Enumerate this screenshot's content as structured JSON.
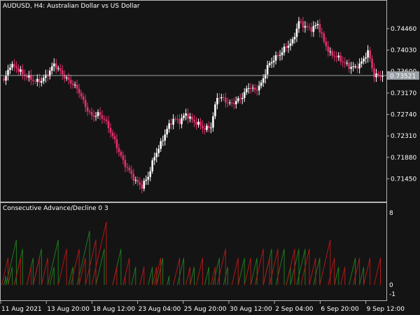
{
  "main_chart": {
    "title": "AUDUSD, H4:  Australian Dollar vs US Dollar",
    "current_price_label": "0.73521",
    "current_price": 0.73521,
    "price_label_overlap": "0.73600"
  },
  "indicator": {
    "title": "Consecutive Advance/Decline 0 3"
  },
  "colors": {
    "background": "#141414",
    "frame": "#b4b4b4",
    "bull_candle": "#ffffff",
    "bear_candle": "#e0306a",
    "price_line": "#9aa0a6",
    "price_label_bg": "#9aa0a6",
    "advance_line": "#1f7a1f",
    "decline_line": "#b01818"
  },
  "chart_data": [
    {
      "type": "candlestick",
      "title": "AUDUSD, H4:  Australian Dollar vs US Dollar",
      "price_axis_ticks": [
        "0.74460",
        "0.74030",
        "0.73600",
        "0.73170",
        "0.72740",
        "0.72310",
        "0.71880",
        "0.71450"
      ],
      "time_axis_ticks": [
        "11 Aug 2021",
        "13 Aug 20:00",
        "18 Aug 12:00",
        "23 Aug 04:00",
        "25 Aug 20:00",
        "30 Aug 12:00",
        "2 Sep 04:00",
        "6 Sep 20:00",
        "9 Sep 12:00"
      ],
      "ylim": [
        0.7105,
        0.7495
      ],
      "close_path": [
        [
          0,
          0.734
        ],
        [
          3,
          0.7373
        ],
        [
          6,
          0.7368
        ],
        [
          9,
          0.7355
        ],
        [
          12,
          0.7348
        ],
        [
          15,
          0.734
        ],
        [
          18,
          0.7342
        ],
        [
          21,
          0.7355
        ],
        [
          24,
          0.7375
        ],
        [
          27,
          0.736
        ],
        [
          30,
          0.7345
        ],
        [
          33,
          0.7335
        ],
        [
          36,
          0.732
        ],
        [
          39,
          0.729
        ],
        [
          42,
          0.727
        ],
        [
          45,
          0.7275
        ],
        [
          48,
          0.7265
        ],
        [
          51,
          0.724
        ],
        [
          54,
          0.721
        ],
        [
          57,
          0.718
        ],
        [
          60,
          0.716
        ],
        [
          63,
          0.714
        ],
        [
          66,
          0.713
        ],
        [
          69,
          0.715
        ],
        [
          72,
          0.719
        ],
        [
          75,
          0.7215
        ],
        [
          78,
          0.7245
        ],
        [
          81,
          0.7265
        ],
        [
          84,
          0.726
        ],
        [
          87,
          0.7275
        ],
        [
          90,
          0.7262
        ],
        [
          93,
          0.7255
        ],
        [
          96,
          0.7245
        ],
        [
          99,
          0.725
        ],
        [
          102,
          0.731
        ],
        [
          105,
          0.7305
        ],
        [
          108,
          0.7295
        ],
        [
          111,
          0.73
        ],
        [
          114,
          0.731
        ],
        [
          117,
          0.733
        ],
        [
          120,
          0.7322
        ],
        [
          123,
          0.7335
        ],
        [
          126,
          0.737
        ],
        [
          129,
          0.7385
        ],
        [
          132,
          0.7395
        ],
        [
          135,
          0.741
        ],
        [
          138,
          0.742
        ],
        [
          141,
          0.746
        ],
        [
          144,
          0.745
        ],
        [
          147,
          0.7445
        ],
        [
          150,
          0.7455
        ],
        [
          153,
          0.742
        ],
        [
          156,
          0.7395
        ],
        [
          159,
          0.739
        ],
        [
          162,
          0.738
        ],
        [
          165,
          0.737
        ],
        [
          168,
          0.7368
        ],
        [
          171,
          0.7378
        ],
        [
          174,
          0.74
        ],
        [
          177,
          0.7352
        ]
      ],
      "series": [
        {
          "name": "AUDUSD"
        }
      ]
    },
    {
      "type": "line",
      "title": "Consecutive Advance/Decline 0 3",
      "value_axis_ticks": [
        "8",
        "0",
        "-1"
      ],
      "ylim": [
        -1,
        8
      ],
      "series": [
        {
          "color": "green",
          "peaks": [
            [
              1,
              1
            ],
            [
              4,
              2
            ],
            [
              6,
              5
            ],
            [
              9,
              4
            ],
            [
              14,
              3
            ],
            [
              18,
              4
            ],
            [
              24,
              2
            ],
            [
              26,
              5
            ],
            [
              33,
              2
            ],
            [
              41,
              6
            ],
            [
              48,
              4
            ],
            [
              56,
              4
            ],
            [
              63,
              2
            ],
            [
              71,
              2
            ],
            [
              76,
              3
            ],
            [
              79,
              1
            ],
            [
              86,
              3
            ],
            [
              91,
              2
            ],
            [
              98,
              2
            ],
            [
              103,
              3
            ],
            [
              107,
              2
            ],
            [
              115,
              3
            ],
            [
              121,
              3
            ],
            [
              128,
              4
            ],
            [
              134,
              4
            ],
            [
              137,
              2
            ],
            [
              141,
              4
            ],
            [
              144,
              4
            ],
            [
              151,
              3
            ],
            [
              160,
              2
            ],
            [
              168,
              3
            ],
            [
              172,
              2
            ]
          ]
        },
        {
          "color": "red",
          "peaks": [
            [
              2,
              3
            ],
            [
              8,
              3
            ],
            [
              13,
              2
            ],
            [
              17,
              3
            ],
            [
              21,
              3
            ],
            [
              30,
              4
            ],
            [
              36,
              4
            ],
            [
              39,
              3
            ],
            [
              44,
              5
            ],
            [
              49,
              7
            ],
            [
              54,
              2
            ],
            [
              58,
              1
            ],
            [
              60,
              3
            ],
            [
              67,
              2
            ],
            [
              73,
              2
            ],
            [
              75,
              3
            ],
            [
              84,
              3
            ],
            [
              89,
              2
            ],
            [
              95,
              3
            ],
            [
              101,
              2
            ],
            [
              106,
              4
            ],
            [
              112,
              3
            ],
            [
              118,
              3
            ],
            [
              124,
              4
            ],
            [
              127,
              3
            ],
            [
              131,
              4
            ],
            [
              139,
              4
            ],
            [
              146,
              4
            ],
            [
              149,
              3
            ],
            [
              156,
              5
            ],
            [
              158,
              3
            ],
            [
              163,
              2
            ],
            [
              170,
              3
            ],
            [
              175,
              3
            ],
            [
              180,
              3
            ]
          ]
        }
      ]
    }
  ]
}
